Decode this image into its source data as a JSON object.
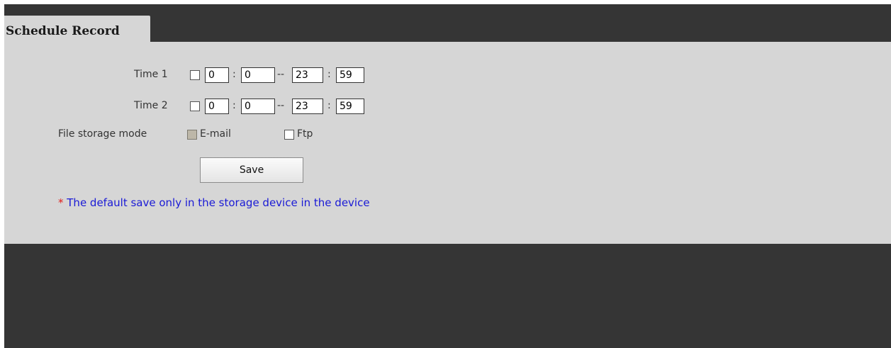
{
  "tab": {
    "title": "Schedule Record"
  },
  "schedule": {
    "rows": [
      {
        "label": "Time 1",
        "start_hour": "0",
        "start_minute": "0",
        "end_hour": "23",
        "end_minute": "59",
        "enabled": false
      },
      {
        "label": "Time 2",
        "start_hour": "0",
        "start_minute": "0",
        "end_hour": "23",
        "end_minute": "59",
        "enabled": false
      }
    ],
    "time_separator": ":",
    "range_separator": "--"
  },
  "storage": {
    "label": "File storage mode",
    "options": [
      {
        "label": "E-mail",
        "checked": false,
        "disabled": true
      },
      {
        "label": "Ftp",
        "checked": false,
        "disabled": false
      }
    ]
  },
  "actions": {
    "save_label": "Save"
  },
  "note": {
    "marker": "*",
    "text": " The default save only in the storage device in the device"
  },
  "colors": {
    "background": "#353535",
    "panel": "#d6d6d6",
    "note_text": "#1a1ad6",
    "note_marker": "#e0201c"
  }
}
